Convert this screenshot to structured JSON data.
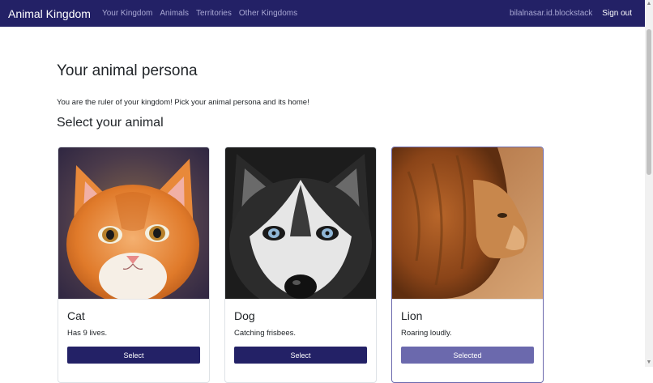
{
  "navbar": {
    "brand": "Animal Kingdom",
    "links": [
      "Your Kingdom",
      "Animals",
      "Territories",
      "Other Kingdoms"
    ],
    "user": "bilalnasar.id.blockstack",
    "signout": "Sign out"
  },
  "main": {
    "title": "Your animal persona",
    "intro": "You are the ruler of your kingdom! Pick your animal persona and its home!",
    "section_title": "Select your animal"
  },
  "animals": [
    {
      "name": "Cat",
      "description": "Has 9 lives.",
      "button": "Select",
      "selected": false,
      "icon": "cat-photo"
    },
    {
      "name": "Dog",
      "description": "Catching frisbees.",
      "button": "Select",
      "selected": false,
      "icon": "husky-photo"
    },
    {
      "name": "Lion",
      "description": "Roaring loudly.",
      "button": "Selected",
      "selected": true,
      "icon": "lion-photo"
    }
  ],
  "colors": {
    "navbar": "#232166",
    "button": "#232166",
    "button_selected": "#6b69ad"
  }
}
